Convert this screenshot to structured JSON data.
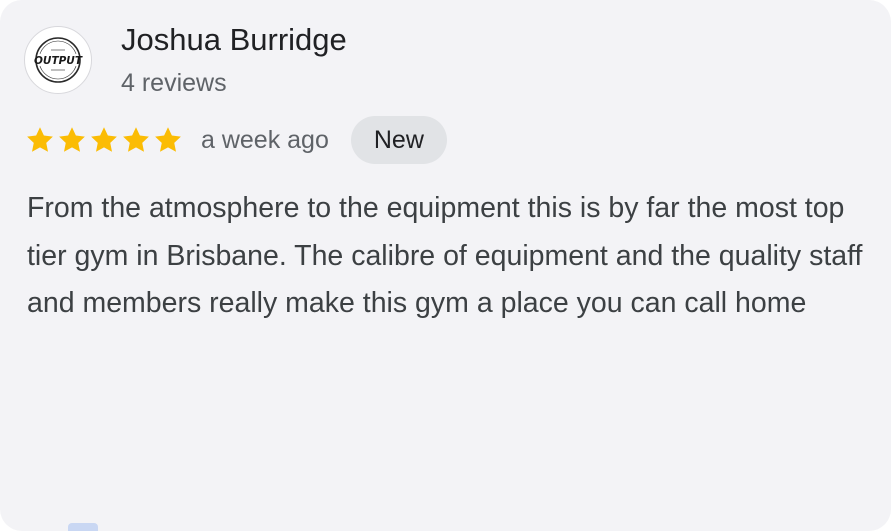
{
  "review": {
    "reviewer": {
      "name": "Joshua Burridge",
      "review_count": "4 reviews",
      "avatar": {
        "icon": "output-gym-logo-icon",
        "logo_text": "OUTPUT"
      }
    },
    "rating": 5,
    "max_rating": 5,
    "date": "a week ago",
    "badge": "New",
    "text": "From the atmosphere to the equipment this is by far the most top tier gym in Brisbane. The calibre of equipment and the quality staff and members really make this gym a place you can call home"
  },
  "colors": {
    "card_background": "#f3f3f6",
    "star_color": "#fbbc04",
    "badge_background": "#e1e3e6",
    "primary_text": "#202124",
    "secondary_text": "#5f6368"
  }
}
